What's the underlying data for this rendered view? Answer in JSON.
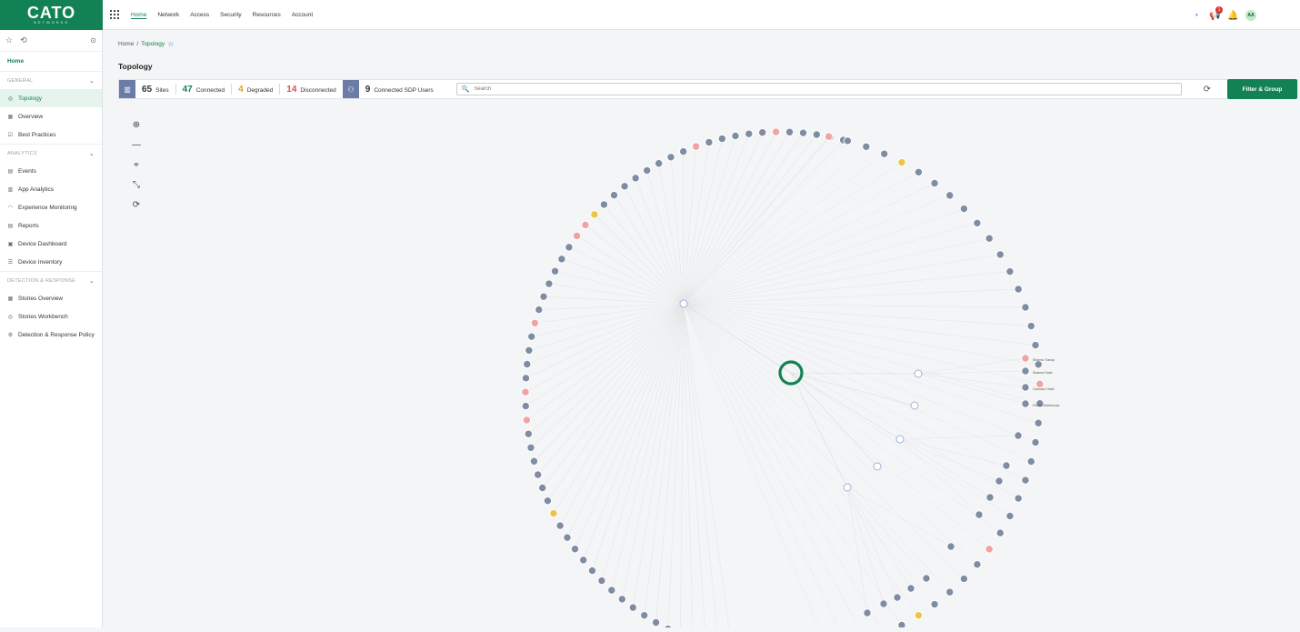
{
  "brand": {
    "name": "CATO",
    "sub": "NETWORKS"
  },
  "nav": [
    "Home",
    "Network",
    "Access",
    "Security",
    "Resources",
    "Account"
  ],
  "topbar": {
    "notification_count": "1",
    "avatar_initials": "AA"
  },
  "sidebar": {
    "home": "Home",
    "sections": [
      {
        "title": "GENERAL",
        "items": [
          {
            "label": "Topology",
            "icon": "topology-icon",
            "glyph": "◎",
            "active": true
          },
          {
            "label": "Overview",
            "icon": "grid-icon",
            "glyph": "▦"
          },
          {
            "label": "Best Practices",
            "icon": "checklist-icon",
            "glyph": "☑"
          }
        ]
      },
      {
        "title": "ANALYTICS",
        "items": [
          {
            "label": "Events",
            "icon": "events-icon",
            "glyph": "▤"
          },
          {
            "label": "App Analytics",
            "icon": "app-analytics-icon",
            "glyph": "▥"
          },
          {
            "label": "Experience Monitoring",
            "icon": "gauge-icon",
            "glyph": "◠"
          },
          {
            "label": "Reports",
            "icon": "reports-icon",
            "glyph": "▤"
          },
          {
            "label": "Device Dashboard",
            "icon": "dashboard-icon",
            "glyph": "▣"
          },
          {
            "label": "Device Inventory",
            "icon": "inventory-icon",
            "glyph": "☰"
          }
        ]
      },
      {
        "title": "DETECTION & RESPONSE",
        "items": [
          {
            "label": "Stories Overview",
            "icon": "stories-icon",
            "glyph": "▦"
          },
          {
            "label": "Stories Workbench",
            "icon": "workbench-icon",
            "glyph": "◎"
          },
          {
            "label": "Detection & Response Policy",
            "icon": "policy-icon",
            "glyph": "⚙"
          }
        ]
      }
    ]
  },
  "breadcrumb": {
    "root": "Home",
    "separator": "/",
    "current": "Topology"
  },
  "page_title": "Topology",
  "stats": {
    "sites": "65",
    "sites_label": "Sites",
    "connected": "47",
    "connected_label": "Connected",
    "degraded": "4",
    "degraded_label": "Degraded",
    "disconnected": "14",
    "disconnected_label": "Disconnected",
    "sdp_users": "9",
    "sdp_users_label": "Connected SDP Users"
  },
  "search": {
    "placeholder": "Search"
  },
  "filter_button": "Filter & Group",
  "colors": {
    "brand": "#128254",
    "connected": "#128254",
    "degraded": "#e7a019",
    "disconnected": "#d9534f",
    "site_node": "#7e8da3",
    "degraded_node": "#f0c24a",
    "disconnected_node": "#f0a3a3",
    "hub": "#128254"
  },
  "topology": {
    "outer_ring": [
      "gray",
      "gray",
      "gray",
      "gray",
      "gray",
      "red",
      "gray",
      "gray",
      "gray",
      "gray",
      "gray",
      "red",
      "gray",
      "gray",
      "gray",
      "gray",
      "gray",
      "gray",
      "gray",
      "gray",
      "yellow",
      "red",
      "red",
      "gray",
      "gray",
      "gray",
      "gray",
      "gray",
      "gray",
      "red",
      "gray",
      "gray",
      "gray",
      "gray",
      "red",
      "gray",
      "red",
      "gray",
      "gray",
      "gray",
      "gray",
      "gray",
      "gray",
      "yellow",
      "gray",
      "gray",
      "gray",
      "gray",
      "gray",
      "gray",
      "gray",
      "gray",
      "gray",
      "gray",
      "gray",
      "gray",
      "gray",
      "red",
      "gray",
      "gray",
      "gray"
    ],
    "right_ring": [
      "red",
      "gray",
      "gray",
      "gray",
      "yellow",
      "gray",
      "gray",
      "gray",
      "gray",
      "gray",
      "gray",
      "gray",
      "gray",
      "gray",
      "gray",
      "gray",
      "gray",
      "gray",
      "red",
      "gray",
      "gray",
      "gray",
      "gray",
      "gray",
      "gray",
      "gray",
      "gray",
      "red",
      "gray",
      "gray",
      "gray",
      "gray",
      "yellow",
      "gray",
      "gray",
      "gray",
      "gray",
      "gray"
    ],
    "visible_labels": [
      "Sharma Transp",
      "Sharma Hubb",
      "Colorado Hubb",
      "Florida Warehouse"
    ]
  }
}
